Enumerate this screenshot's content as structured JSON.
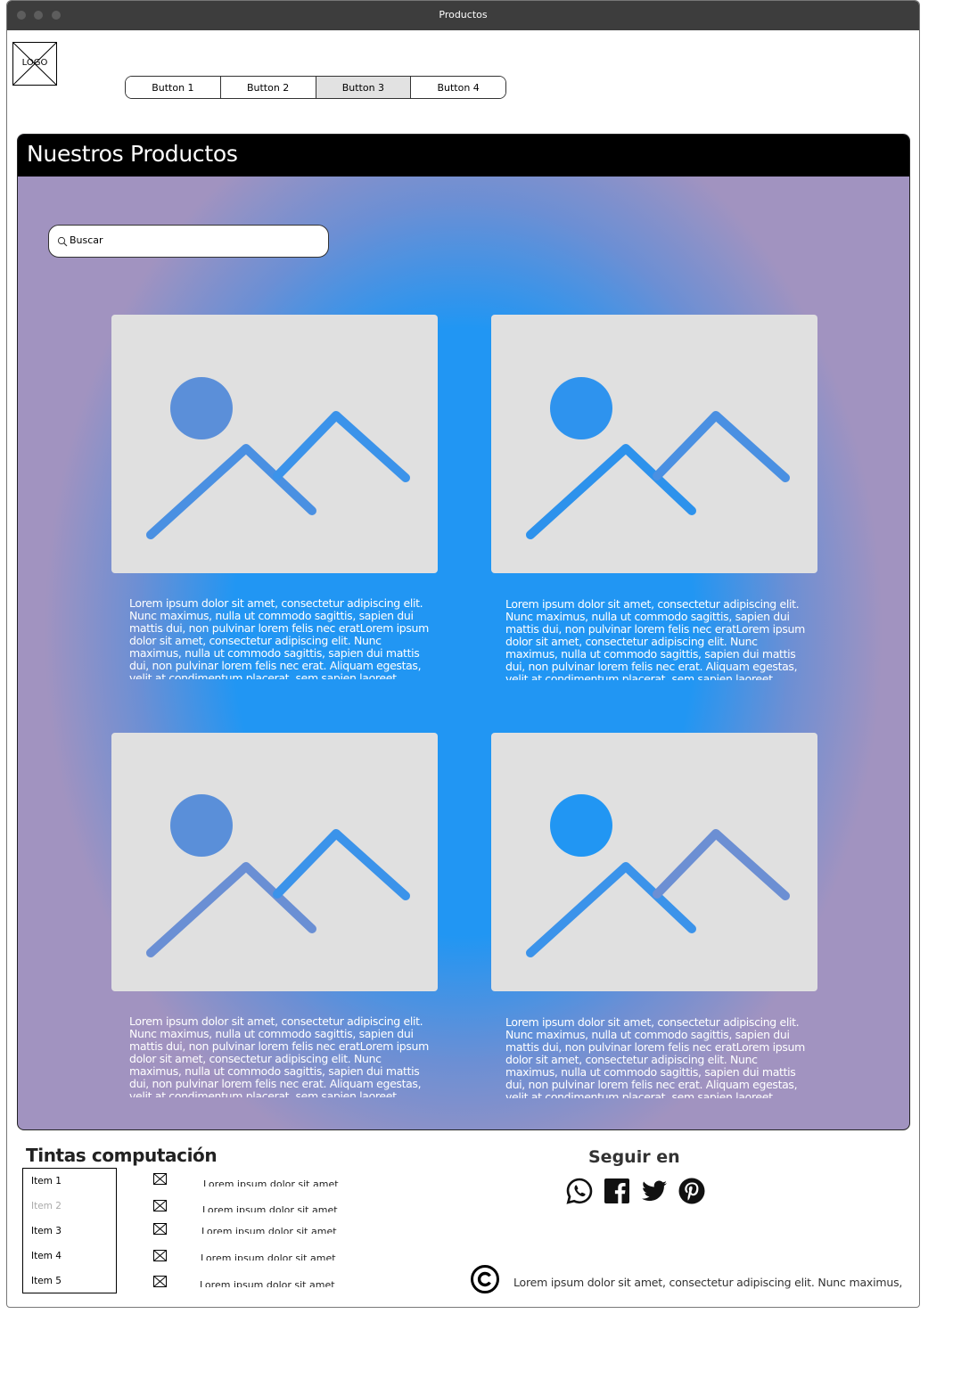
{
  "window": {
    "title": "Productos"
  },
  "logo": {
    "label": "LOGO"
  },
  "nav": {
    "buttons": [
      {
        "label": "Button 1",
        "active": false
      },
      {
        "label": "Button 2",
        "active": false
      },
      {
        "label": "Button 3",
        "active": true
      },
      {
        "label": "Button 4",
        "active": false
      }
    ]
  },
  "products": {
    "title": "Nuestros Productos",
    "search_placeholder": "Buscar",
    "items": [
      {
        "image_icon": "image-placeholder-icon",
        "text": "Lorem ipsum dolor sit amet, consectetur adipiscing elit. Nunc maximus, nulla ut commodo sagittis, sapien dui mattis dui, non pulvinar lorem felis nec eratLorem ipsum dolor sit amet, consectetur adipiscing elit. Nunc maximus, nulla ut commodo sagittis, sapien dui mattis dui, non pulvinar lorem felis nec erat. Aliquam egestas, velit at condimentum placerat, sem sapien laoreet"
      },
      {
        "image_icon": "image-placeholder-icon",
        "text": "Lorem ipsum dolor sit amet, consectetur adipiscing elit. Nunc maximus, nulla ut commodo sagittis, sapien dui mattis dui, non pulvinar lorem felis nec eratLorem ipsum dolor sit amet, consectetur adipiscing elit. Nunc maximus, nulla ut commodo sagittis, sapien dui mattis dui, non pulvinar lorem felis nec erat. Aliquam egestas, velit at condimentum placerat, sem sapien laoreet"
      },
      {
        "image_icon": "image-placeholder-icon",
        "text": "Lorem ipsum dolor sit amet, consectetur adipiscing elit. Nunc maximus, nulla ut commodo sagittis, sapien dui mattis dui, non pulvinar lorem felis nec eratLorem ipsum dolor sit amet, consectetur adipiscing elit. Nunc maximus, nulla ut commodo sagittis, sapien dui mattis dui, non pulvinar lorem felis nec erat. Aliquam egestas, velit at condimentum placerat, sem sapien laoreet"
      },
      {
        "image_icon": "image-placeholder-icon",
        "text": "Lorem ipsum dolor sit amet, consectetur adipiscing elit. Nunc maximus, nulla ut commodo sagittis, sapien dui mattis dui, non pulvinar lorem felis nec eratLorem ipsum dolor sit amet, consectetur adipiscing elit. Nunc maximus, nulla ut commodo sagittis, sapien dui mattis dui, non pulvinar lorem felis nec erat. Aliquam egestas, velit at condimentum placerat, sem sapien laoreet"
      }
    ]
  },
  "footer": {
    "title": "Tintas computación",
    "list": [
      {
        "label": "Item 1",
        "disabled": false
      },
      {
        "label": "Item 2",
        "disabled": true
      },
      {
        "label": "Item 3",
        "disabled": false
      },
      {
        "label": "Item 4",
        "disabled": false
      },
      {
        "label": "Item 5",
        "disabled": false
      }
    ],
    "links": [
      {
        "icon": "image-placeholder-icon",
        "text": "Lorem ipsum dolor sit amet"
      },
      {
        "icon": "image-placeholder-icon",
        "text": "Lorem ipsum dolor sit amet"
      },
      {
        "icon": "image-placeholder-icon",
        "text": "Lorem ipsum dolor sit amet"
      },
      {
        "icon": "image-placeholder-icon",
        "text": "Lorem ipsum dolor sit amet"
      },
      {
        "icon": "image-placeholder-icon",
        "text": "Lorem ipsum dolor sit amet"
      }
    ],
    "follow_title": "Seguir en",
    "social": [
      "whatsapp-icon",
      "facebook-icon",
      "twitter-icon",
      "pinterest-icon"
    ],
    "copyright_text": "Lorem ipsum dolor sit amet, consectetur adipiscing elit. Nunc maximus,"
  },
  "colors": {
    "panel_center": "#2196f3",
    "panel_edge": "#a193c0",
    "header_bar": "#000000",
    "card_background": "#e0e0e0",
    "titlebar": "#3d3d3d"
  }
}
